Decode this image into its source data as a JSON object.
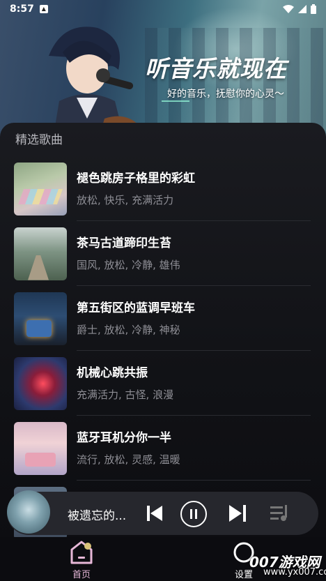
{
  "status": {
    "time": "8:57"
  },
  "banner": {
    "title": "听音乐就现在",
    "subtitle": "好的音乐，抚慰你的心灵～"
  },
  "section": {
    "title": "精选歌曲"
  },
  "songs": [
    {
      "title": "褪色跳房子格里的彩虹",
      "tags": "放松, 快乐, 充满活力"
    },
    {
      "title": "茶马古道蹄印生苔",
      "tags": "国风, 放松, 冷静, 雄伟"
    },
    {
      "title": "第五街区的蓝调早班车",
      "tags": "爵士, 放松, 冷静, 神秘"
    },
    {
      "title": "机械心跳共振",
      "tags": "充满活力, 古怪, 浪漫"
    },
    {
      "title": "蓝牙耳机分你一半",
      "tags": "流行, 放松, 灵感, 温暖"
    }
  ],
  "player": {
    "title": "被遗忘的..."
  },
  "nav": {
    "home": "首页",
    "settings": "设置"
  },
  "watermark": {
    "brand": "007游戏网",
    "url": "www.yx007.com"
  },
  "colors": {
    "accent": "#e7b8d8",
    "background": "#0c0c10"
  }
}
